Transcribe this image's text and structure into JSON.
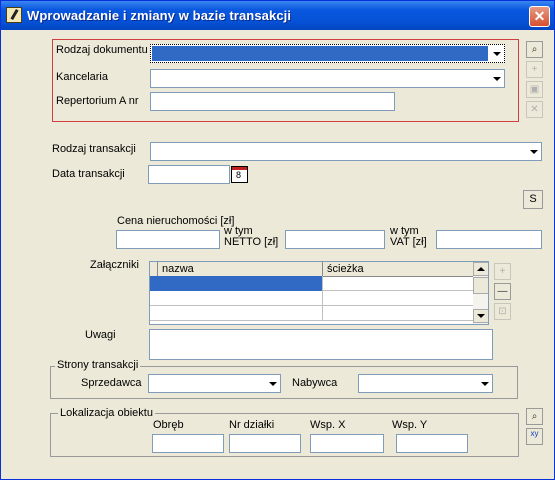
{
  "window": {
    "title": "Wprowadzanie i zmiany w bazie transakcji",
    "close_glyph": "✕"
  },
  "document": {
    "type_label": "Rodzaj dokumentu",
    "type_value": "",
    "office_label": "Kancelaria",
    "office_value": "",
    "repertorium_label": "Repertorium A nr",
    "repertorium_value": ""
  },
  "side_buttons": {
    "binoculars": "⌕",
    "add": "+",
    "save": "▣",
    "delete": "✕"
  },
  "transaction": {
    "type_label": "Rodzaj transakcji",
    "type_value": "",
    "date_label": "Data transakcji",
    "date_value": "",
    "calendar_day": "8"
  },
  "s_button": "S",
  "price": {
    "label": "Cena nieruchomości [zł]",
    "netto_label_1": "w tym",
    "netto_label_2": "NETTO [zł]",
    "vat_label_1": "w tym",
    "vat_label_2": "VAT [zł]",
    "price_value": "",
    "netto_value": "",
    "vat_value": ""
  },
  "attachments": {
    "label": "Załączniki",
    "columns": [
      "nazwa",
      "ścieżka"
    ],
    "rows": [
      [
        "",
        ""
      ],
      [
        "",
        ""
      ],
      [
        "",
        ""
      ]
    ],
    "selected_row": 0,
    "add": "+",
    "remove": "—",
    "open": "⊡"
  },
  "notes": {
    "label": "Uwagi",
    "value": ""
  },
  "parties": {
    "group_title": "Strony transakcji",
    "seller_label": "Sprzedawca",
    "buyer_label": "Nabywca",
    "seller_value": "",
    "buyer_value": ""
  },
  "location": {
    "group_title": "Lokalizacja obiektu",
    "obreb_label": "Obręb",
    "dzialka_label": "Nr działki",
    "x_label": "Wsp. X",
    "y_label": "Wsp. Y",
    "obreb_value": "",
    "dzialka_value": "",
    "x_value": "",
    "y_value": "",
    "coords_button": "xy"
  },
  "colors": {
    "title_bar": "#0A58E0",
    "selection": "#316AC5",
    "frame": "#ECE9D8",
    "required_border": "#D04040"
  }
}
